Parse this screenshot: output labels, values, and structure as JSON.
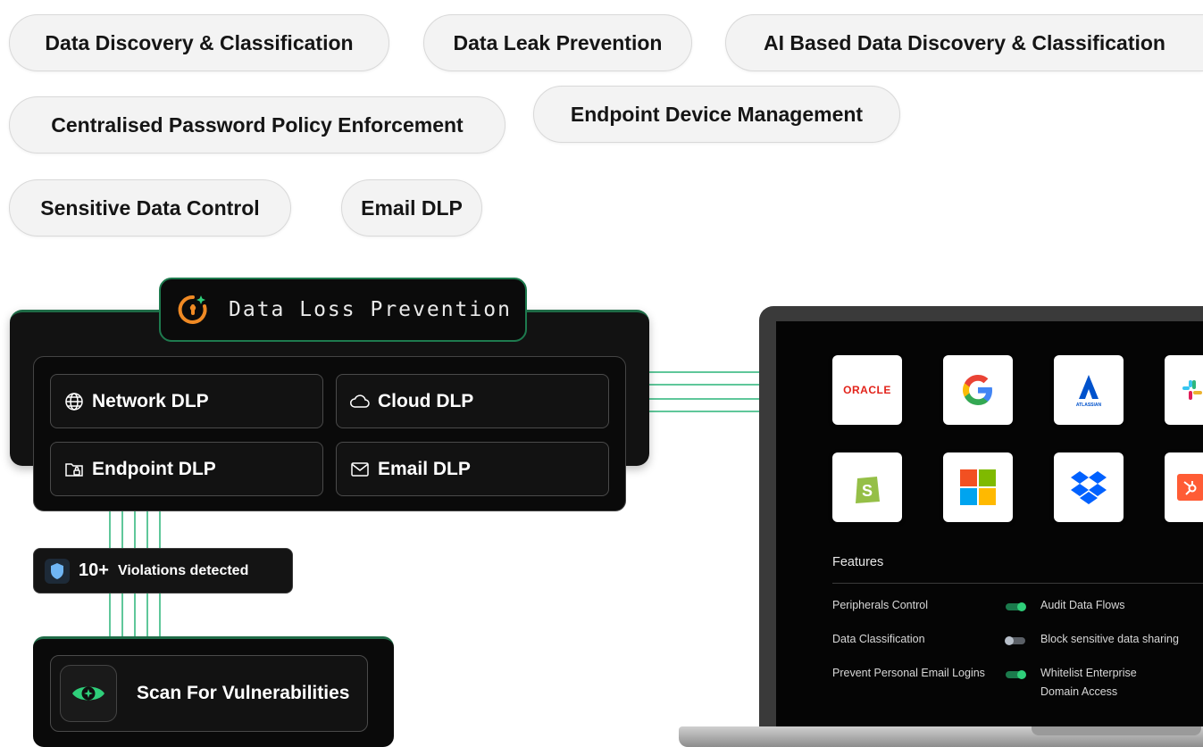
{
  "feature_pills": [
    "Data Discovery & Classification",
    "Data Leak Prevention",
    "AI Based Data Discovery & Classification",
    "Centralised Password Policy Enforcement",
    "Endpoint Device Management",
    "Sensitive Data Control",
    "Email DLP"
  ],
  "dlp_panel": {
    "title": "Data Loss Prevention",
    "title_icon": "lock-power-icon",
    "modules": [
      {
        "label": "Network DLP",
        "icon": "globe-icon"
      },
      {
        "label": "Cloud DLP",
        "icon": "cloud-icon"
      },
      {
        "label": "Endpoint DLP",
        "icon": "folder-lock-icon"
      },
      {
        "label": "Email DLP",
        "icon": "envelope-icon"
      }
    ]
  },
  "violations": {
    "count": "10+",
    "label": "Violations detected",
    "icon": "shield-icon"
  },
  "scan": {
    "label": "Scan For Vulnerabilities",
    "icon": "eye-icon"
  },
  "laptop": {
    "apps_row1": [
      {
        "name": "oracle-logo",
        "text": "ORACLE"
      },
      {
        "name": "google-logo",
        "text": "G"
      },
      {
        "name": "atlassian-logo",
        "text": "ATLASSIAN"
      },
      {
        "name": "slack-logo",
        "text": ""
      }
    ],
    "apps_row2": [
      {
        "name": "shopify-logo",
        "text": "S"
      },
      {
        "name": "microsoft-logo",
        "text": ""
      },
      {
        "name": "dropbox-logo",
        "text": ""
      },
      {
        "name": "hubspot-logo",
        "text": ""
      }
    ],
    "features_title": "Features",
    "features_left": [
      "Peripherals Control",
      "Data Classification",
      "Prevent Personal Email Logins"
    ],
    "features_right": [
      {
        "label": "Audit Data Flows",
        "on": true
      },
      {
        "label": "Block sensitive data sharing",
        "on": false
      },
      {
        "label": "Whitelist Enterprise",
        "label2": "Domain Access",
        "on": true
      }
    ]
  },
  "colors": {
    "accent_green": "#2fcf7a",
    "line_green": "#5fc79a",
    "orange": "#f08a24",
    "shield_blue": "#6fb6f5"
  }
}
